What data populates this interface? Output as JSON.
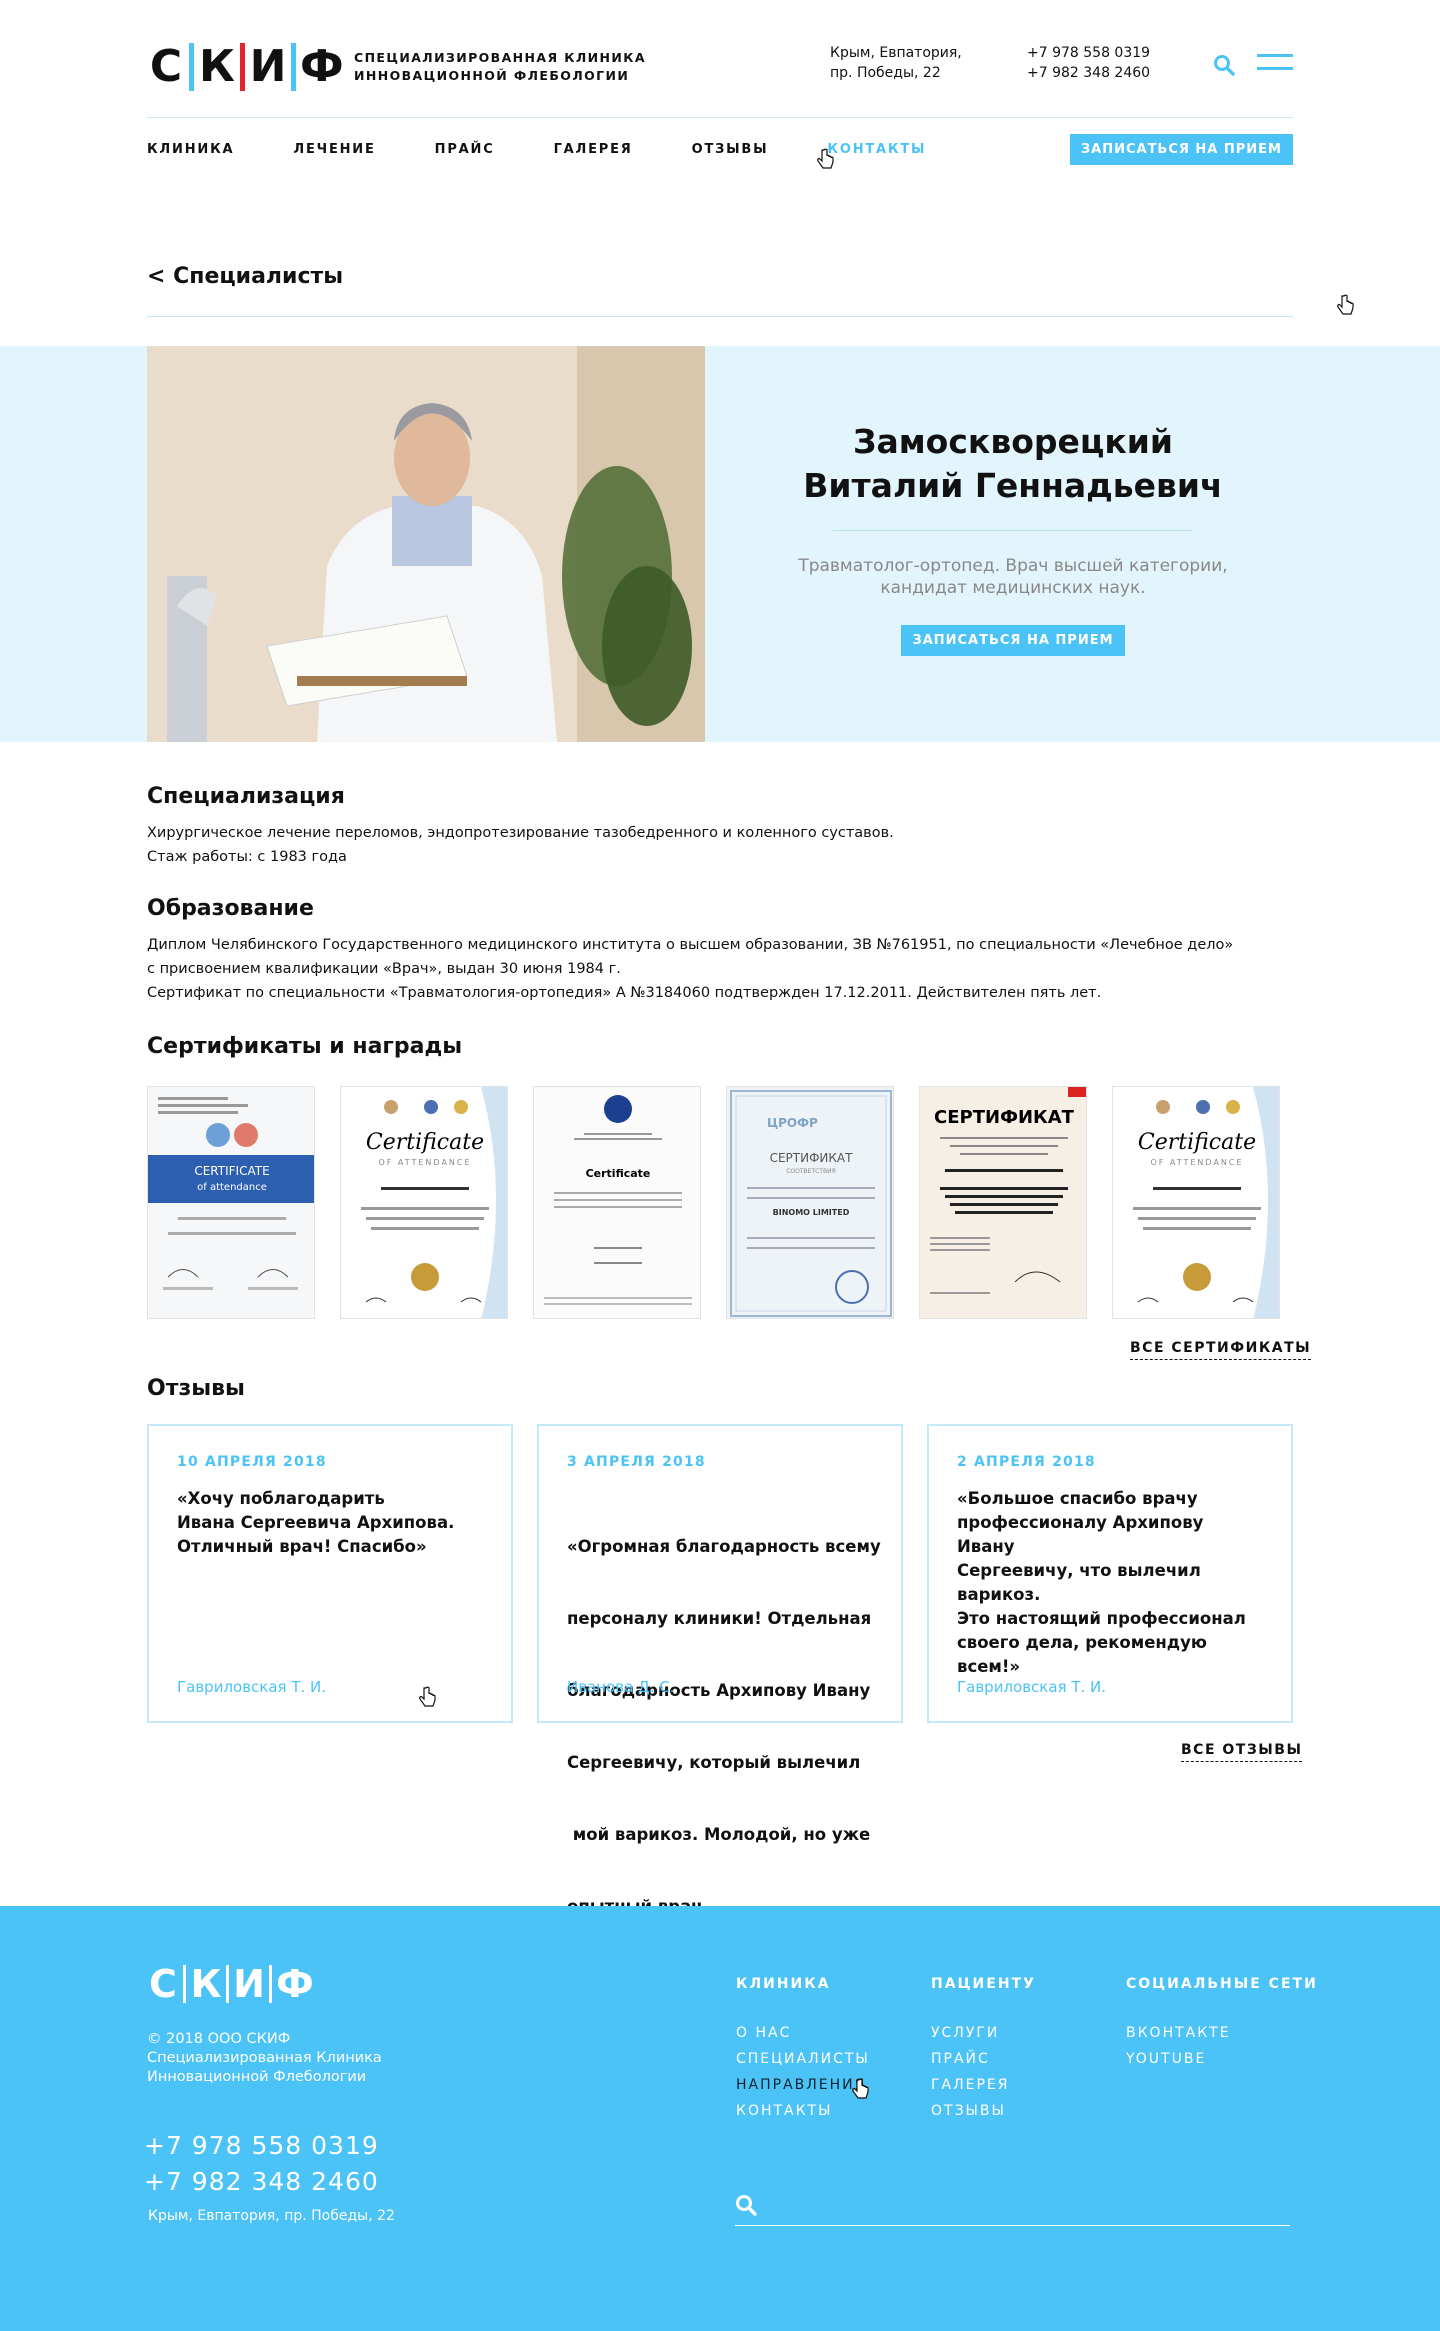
{
  "header": {
    "logo_letters": [
      "С",
      "К",
      "И",
      "Ф"
    ],
    "logo_bar_colors": [
      "#4cc3f7",
      "#e2262b",
      "#4cc3f7"
    ],
    "logo_line1": "Специализированная клиника",
    "logo_line2": "инновационной флебологии",
    "address_line1": "Крым, Евпатория,",
    "address_line2": "пр. Победы, 22",
    "phone1": "+7 978 558 0319",
    "phone2": "+7 982 348 2460",
    "search_icon": "search-icon",
    "menu_icon": "hamburger-icon"
  },
  "nav": {
    "items": [
      {
        "label": "Клиника",
        "active": false
      },
      {
        "label": "Лечение",
        "active": false
      },
      {
        "label": "Прайс",
        "active": false
      },
      {
        "label": "Галерея",
        "active": false
      },
      {
        "label": "Отзывы",
        "active": false
      },
      {
        "label": "Контакты",
        "active": true
      }
    ],
    "cta": "Записаться на прием"
  },
  "back_link": "< Специалисты",
  "doctor": {
    "name_line1": "Замоскворецкий",
    "name_line2": "Виталий Геннадьевич",
    "description_line1": "Травматолог-ортопед. Врач высшей категории,",
    "description_line2": "кандидат медицинских наук.",
    "cta": "Записаться на прием"
  },
  "specialization": {
    "title": "Специализация",
    "line1": "Хирургическое лечение переломов, эндопротезирование тазобедренного и коленного суставов.",
    "line2": "Стаж работы: с 1983 года"
  },
  "education": {
    "title": "Образование",
    "line1": "Диплом Челябинского Государственного медицинского института о высшем образовании, ЗВ №761951, по специальности «Лечебное дело»",
    "line2": "с присвоением квалификации «Врач», выдан 30 июня 1984 г.",
    "line3": "Сертификат по специальности «Травматология-ортопедия» А №3184060 подтвержден 17.12.2011. Действителен пять лет."
  },
  "certificates": {
    "title": "Сертификаты и награды",
    "items": [
      {
        "heading": "CERTIFICATE",
        "subheading": "of attendance",
        "accent": "#2d5fb0"
      },
      {
        "heading": "Certificate",
        "subheading": "OF ATTENDANCE",
        "accent": "#b88a3a"
      },
      {
        "heading": "Certificate",
        "subheading": "",
        "accent": "#1d3f8f"
      },
      {
        "heading": "СЕРТИФИКАТ",
        "subheading": "СООТВЕТСТВИЯ",
        "accent": "#6b8fb8"
      },
      {
        "heading": "СЕРТИФИКАТ",
        "subheading": "",
        "accent": "#4f6b4f"
      },
      {
        "heading": "Certificate",
        "subheading": "OF ATTENDANCE",
        "accent": "#b88a3a"
      }
    ],
    "more_label": "Все сертификаты"
  },
  "reviews": {
    "title": "Отзывы",
    "items": [
      {
        "date": "10 апреля 2018",
        "text_lines": [
          "«Хочу поблагодарить",
          "Ивана Сергеевича Архипова.",
          "Отличный врач! Спасибо»"
        ],
        "author": "Гавриловская Т. И."
      },
      {
        "date": "3 апреля 2018",
        "text_lines": [
          "«Огромная благодарность всему",
          "персоналу клиники! Отдельная",
          "благодарность Архипову Ивану",
          "Сергеевичу, который вылечил",
          " мой варикоз. Молодой, но уже",
          "опытный врач ..."
        ],
        "author": "Иванова Д. С."
      },
      {
        "date": "2 апреля 2018",
        "text_lines": [
          "«Большое спасибо врачу",
          "профессионалу Архипову Ивану",
          "Сергеевичу, что вылечил варикоз.",
          "Это настоящий профессионал",
          "своего дела, рекомендую всем!»"
        ],
        "author": "Гавриловская Т. И."
      }
    ],
    "more_label": "Все отзывы"
  },
  "footer": {
    "logo_letters": [
      "С",
      "К",
      "И",
      "Ф"
    ],
    "copyright_line1": "© 2018 ООО СКИФ",
    "copyright_line2": "Специализированная Клиника",
    "copyright_line3": "Инновационной Флебологии",
    "phone1": "+7 978 558 0319",
    "phone2": "+7 982 348 2460",
    "address": "Крым, Евпатория, пр. Победы, 22",
    "columns": [
      {
        "title": "Клиника",
        "links": [
          {
            "label": "О нас",
            "active": false
          },
          {
            "label": "Специалисты",
            "active": false
          },
          {
            "label": "Направления",
            "active": true
          },
          {
            "label": "Контакты",
            "active": false
          }
        ]
      },
      {
        "title": "Пациенту",
        "links": [
          {
            "label": "Услуги",
            "active": false
          },
          {
            "label": "Прайс",
            "active": false
          },
          {
            "label": "Галерея",
            "active": false
          },
          {
            "label": "Отзывы",
            "active": false
          }
        ]
      },
      {
        "title": "Социальные сети",
        "links": [
          {
            "label": "Вконтакте",
            "active": false
          },
          {
            "label": "YouTube",
            "active": false
          }
        ]
      }
    ],
    "search_icon": "search-icon"
  },
  "colors": {
    "accent": "#4cc3f7",
    "logo_red": "#e2262b",
    "hero_bg": "#e3f5fc",
    "text": "#111111"
  }
}
